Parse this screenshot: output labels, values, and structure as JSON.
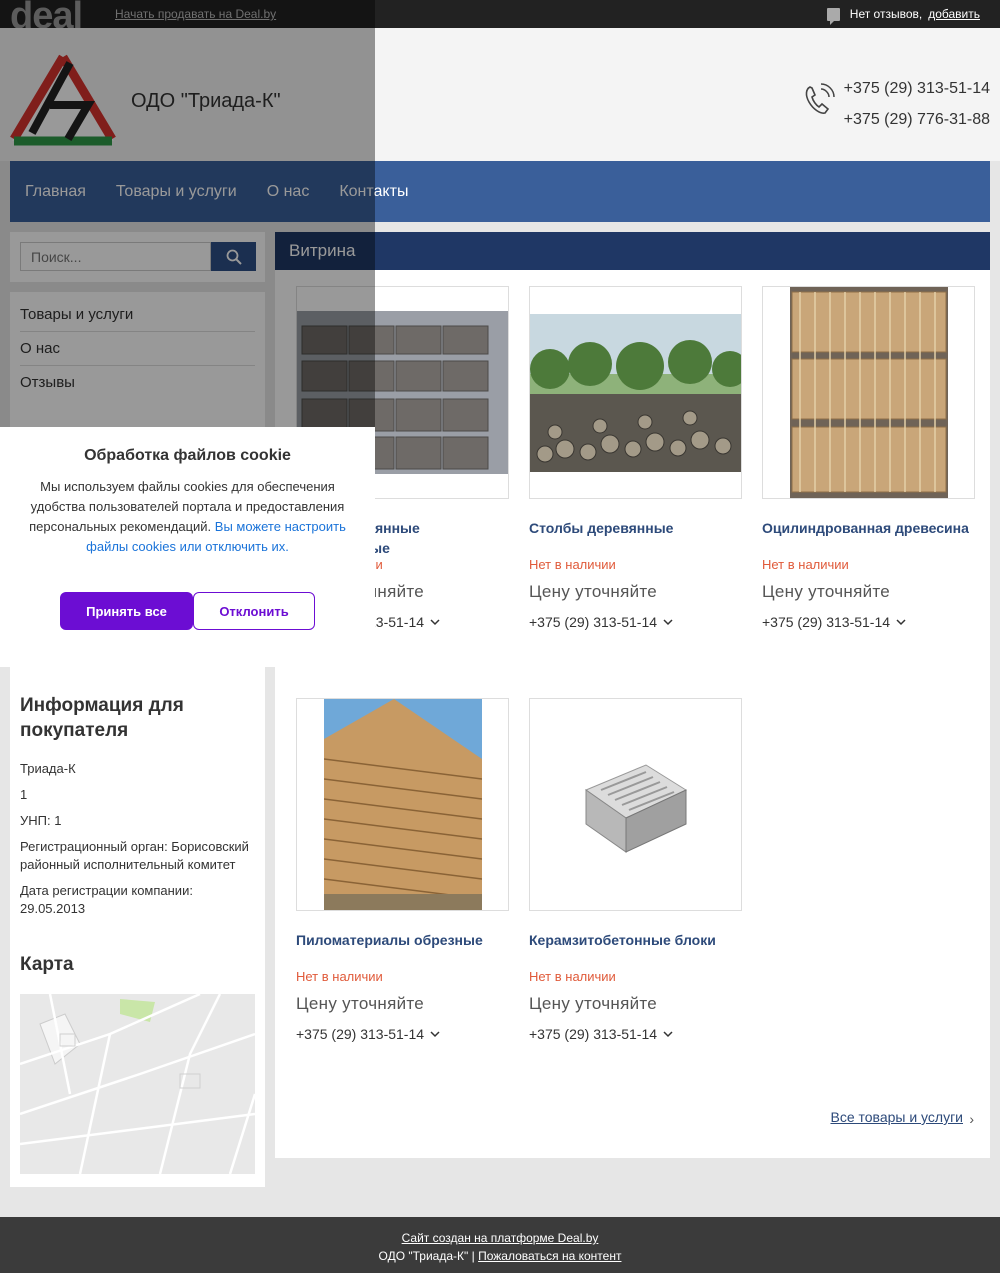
{
  "topbar": {
    "logo": "deal",
    "sell_link": "Начать продавать на Deal.by",
    "reviews_text": "Нет отзывов,",
    "reviews_add": "добавить"
  },
  "header": {
    "company_name": "ОДО \"Триада-К\"",
    "phones": [
      "+375 (29) 313-51-14",
      "+375 (29) 776-31-88"
    ]
  },
  "nav": [
    "Главная",
    "Товары и услуги",
    "О нас",
    "Контакты"
  ],
  "search": {
    "placeholder": "Поиск..."
  },
  "side_menu": [
    "Товары и услуги",
    "О нас",
    "Отзывы"
  ],
  "info": {
    "title": "Информация для покупателя",
    "company": "Триада-К",
    "line1": "1",
    "unp": "УНП: 1",
    "reg_organ": "Регистрационный орган: Борисовский районный исполнительный комитет",
    "reg_date": "Дата регистрации компании: 29.05.2013",
    "map_title": "Карта"
  },
  "showcase": {
    "title": "Витрина",
    "products": [
      {
        "name": "Брус деревянные пропитанные",
        "stock": "Нет в наличии",
        "price": "Цену уточняйте",
        "phone": "+375 (29) 313-51-14",
        "image": "stacked-beams"
      },
      {
        "name": "Столбы деревянные",
        "stock": "Нет в наличии",
        "price": "Цену уточняйте",
        "phone": "+375 (29) 313-51-14",
        "image": "log-pile"
      },
      {
        "name": "Оцилиндрованная древесина",
        "stock": "Нет в наличии",
        "price": "Цену уточняйте",
        "phone": "+375 (29) 313-51-14",
        "image": "rounded-poles"
      },
      {
        "name": "Пиломатериалы обрезные",
        "stock": "Нет в наличии",
        "price": "Цену уточняйте",
        "phone": "+375 (29) 313-51-14",
        "image": "lumber-stack"
      },
      {
        "name": "Керамзитобетонные блоки",
        "stock": "Нет в наличии",
        "price": "Цену уточняйте",
        "phone": "+375 (29) 313-51-14",
        "image": "concrete-block"
      }
    ],
    "all_link": "Все товары и услуги"
  },
  "footer": {
    "platform": "Сайт создан на платформе Deal.by",
    "company": "ОДО \"Триада-К\" |",
    "complain": "Пожаловаться на контент"
  },
  "cookie": {
    "title": "Обработка файлов cookie",
    "text": "Мы используем файлы cookies для обеспечения удобства пользователей портала и предоставления персональных рекомендаций.",
    "link": "Вы можете настроить файлы cookies или отключить их.",
    "accept": "Принять все",
    "decline": "Отклонить"
  },
  "colors": {
    "nav": "#3a5f9a",
    "showcase_header": "#1f3765",
    "out_of_stock": "#e05a3a",
    "cookie_accent": "#6c0dd3"
  }
}
